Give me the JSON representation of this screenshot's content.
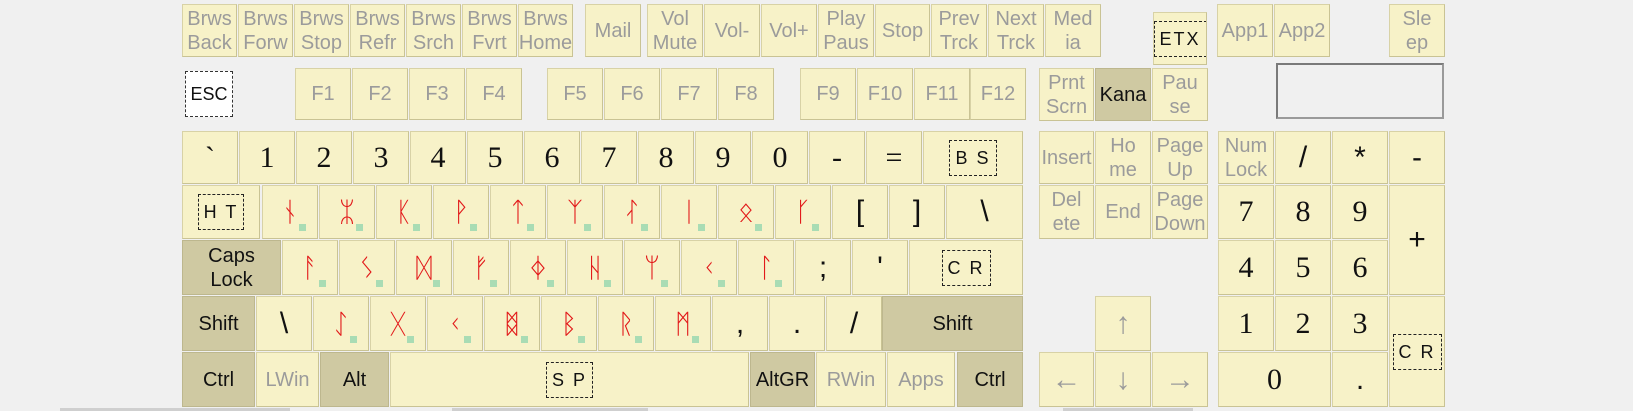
{
  "keyboard": {
    "media_row": [
      {
        "label": "Brws\nBack"
      },
      {
        "label": "Brws\nForw"
      },
      {
        "label": "Brws\nStop"
      },
      {
        "label": "Brws\nRefr"
      },
      {
        "label": "Brws\nSrch"
      },
      {
        "label": "Brws\nFvrt"
      },
      {
        "label": "Brws\nHome"
      },
      {
        "label": "Mail"
      },
      {
        "label": "Vol\nMute"
      },
      {
        "label": "Vol-"
      },
      {
        "label": "Vol+"
      },
      {
        "label": "Play\nPaus"
      },
      {
        "label": "Stop"
      },
      {
        "label": "Prev\nTrck"
      },
      {
        "label": "Next\nTrck"
      },
      {
        "label": "Med\nia"
      },
      {
        "label": "ETX"
      },
      {
        "label": "App1"
      },
      {
        "label": "App2"
      },
      {
        "label": "Sle\nep"
      }
    ],
    "function_row": [
      {
        "label": "ESC"
      },
      {
        "label": "F1"
      },
      {
        "label": "F2"
      },
      {
        "label": "F3"
      },
      {
        "label": "F4"
      },
      {
        "label": "F5"
      },
      {
        "label": "F6"
      },
      {
        "label": "F7"
      },
      {
        "label": "F8"
      },
      {
        "label": "F9"
      },
      {
        "label": "F10"
      },
      {
        "label": "F11"
      },
      {
        "label": "F12"
      },
      {
        "label": "Prnt\nScrn"
      },
      {
        "label": "Kana"
      },
      {
        "label": "Pau\nse"
      }
    ],
    "number_row": [
      {
        "label": "`"
      },
      {
        "label": "1"
      },
      {
        "label": "2"
      },
      {
        "label": "3"
      },
      {
        "label": "4"
      },
      {
        "label": "5"
      },
      {
        "label": "6"
      },
      {
        "label": "7"
      },
      {
        "label": "8"
      },
      {
        "label": "9"
      },
      {
        "label": "0"
      },
      {
        "label": "-"
      },
      {
        "label": "="
      },
      {
        "label": "B S"
      }
    ],
    "top_row": [
      {
        "label": "H T"
      },
      {
        "label": "ᚾ"
      },
      {
        "label": "ᛯ"
      },
      {
        "label": "ᛕ"
      },
      {
        "label": "ᚹ"
      },
      {
        "label": "ᛏ"
      },
      {
        "label": "ᛉ"
      },
      {
        "label": "ᛮ"
      },
      {
        "label": "ᛁ"
      },
      {
        "label": "ᛟ"
      },
      {
        "label": "ᚴ"
      },
      {
        "label": "["
      },
      {
        "label": "]"
      },
      {
        "label": "\\"
      }
    ],
    "home_row": [
      {
        "label": "Caps\nLock"
      },
      {
        "label": "ᚨ"
      },
      {
        "label": "ᛊ"
      },
      {
        "label": "ᛞ"
      },
      {
        "label": "ᚠ"
      },
      {
        "label": "ᛄ"
      },
      {
        "label": "ᚺ"
      },
      {
        "label": "ᛘ"
      },
      {
        "label": "ᚲ"
      },
      {
        "label": "ᛚ"
      },
      {
        "label": ";"
      },
      {
        "label": "'"
      },
      {
        "label": "C R"
      }
    ],
    "bottom_row": [
      {
        "label": "Shift"
      },
      {
        "label": "\\"
      },
      {
        "label": "ᛇ"
      },
      {
        "label": "ᚷ"
      },
      {
        "label": "ᚲ"
      },
      {
        "label": "ᛥ"
      },
      {
        "label": "ᛒ"
      },
      {
        "label": "ᚱ"
      },
      {
        "label": "ᛗ"
      },
      {
        "label": ","
      },
      {
        "label": "."
      },
      {
        "label": "/"
      },
      {
        "label": "Shift"
      }
    ],
    "space_row": [
      {
        "label": "Ctrl"
      },
      {
        "label": "LWin"
      },
      {
        "label": "Alt"
      },
      {
        "label": "S P"
      },
      {
        "label": "AltGR"
      },
      {
        "label": "RWin"
      },
      {
        "label": "Apps"
      },
      {
        "label": "Ctrl"
      }
    ],
    "nav_cluster": [
      {
        "label": "Insert"
      },
      {
        "label": "Ho\nme"
      },
      {
        "label": "Page\nUp"
      },
      {
        "label": "Del\nete"
      },
      {
        "label": "End"
      },
      {
        "label": "Page\nDown"
      },
      {
        "label": "↑"
      },
      {
        "label": "←"
      },
      {
        "label": "↓"
      },
      {
        "label": "→"
      }
    ],
    "numpad": [
      {
        "label": "Num\nLock"
      },
      {
        "label": "/"
      },
      {
        "label": "*"
      },
      {
        "label": "-"
      },
      {
        "label": "7"
      },
      {
        "label": "8"
      },
      {
        "label": "9"
      },
      {
        "label": "+"
      },
      {
        "label": "4"
      },
      {
        "label": "5"
      },
      {
        "label": "6"
      },
      {
        "label": "1"
      },
      {
        "label": "2"
      },
      {
        "label": "3"
      },
      {
        "label": "C R"
      },
      {
        "label": "0"
      },
      {
        "label": "."
      }
    ],
    "colors": {
      "key_face": "#f7f2c8",
      "modifier_face": "#cfc9a2",
      "rune": "#e21a1a",
      "dim_label": "#9b9b9b",
      "marker": "#a9dcb4"
    }
  }
}
